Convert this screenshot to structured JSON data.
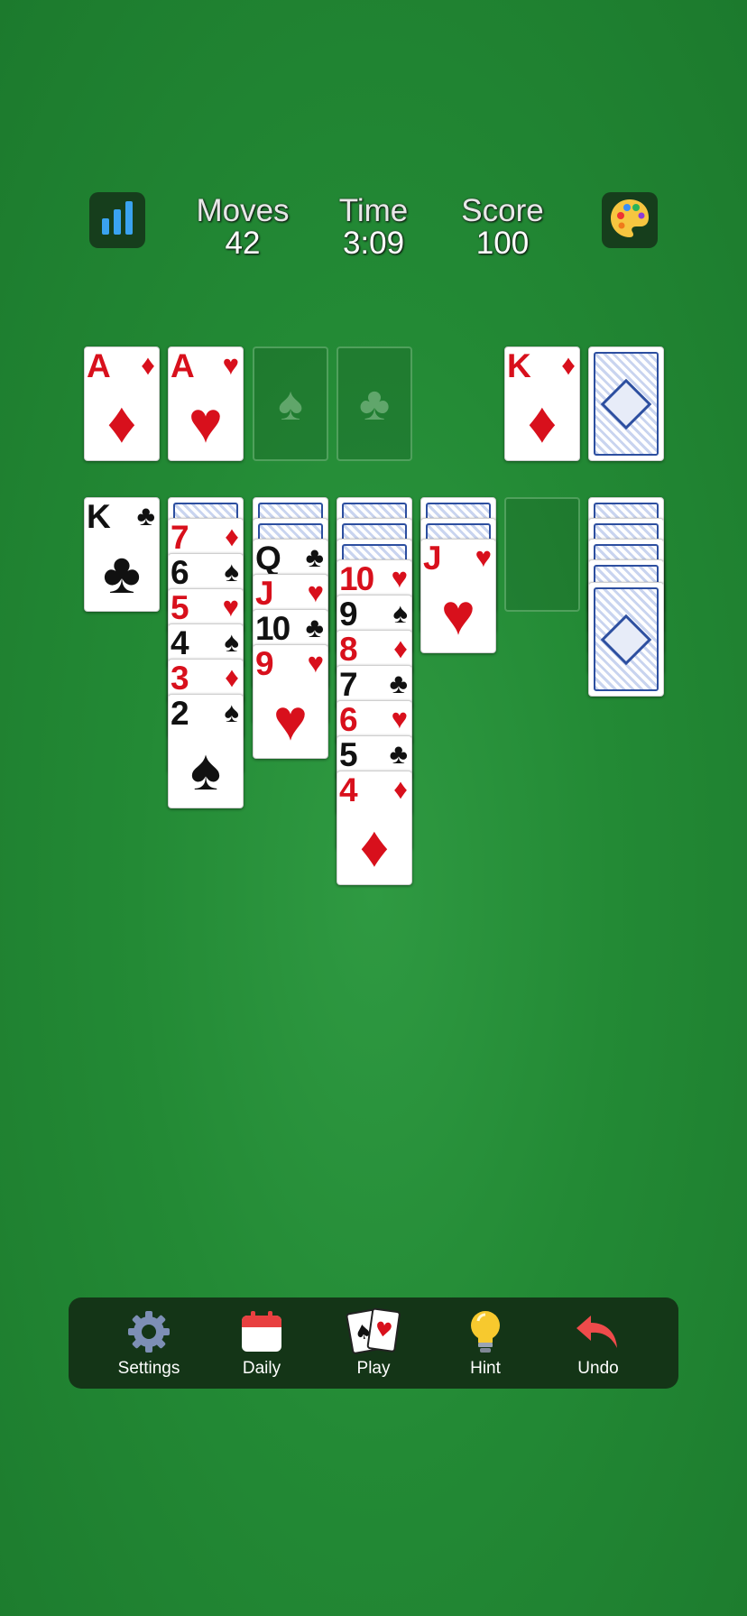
{
  "header": {
    "stats_icon": "bar-chart-icon",
    "theme_icon": "palette-icon",
    "moves_label": "Moves",
    "moves_value": "42",
    "time_label": "Time",
    "time_value": "3:09",
    "score_label": "Score",
    "score_value": "100"
  },
  "foundations": [
    {
      "rank": "A",
      "suit": "♦",
      "color": "red"
    },
    {
      "rank": "A",
      "suit": "♥",
      "color": "red"
    },
    {
      "empty_suit": "♠"
    },
    {
      "empty_suit": "♣"
    }
  ],
  "waste": {
    "rank": "K",
    "suit": "♦",
    "color": "red"
  },
  "stock": {
    "face_down": true
  },
  "tableau": [
    {
      "hidden": 0,
      "cards": [
        {
          "rank": "K",
          "suit": "♣",
          "color": "black"
        }
      ]
    },
    {
      "hidden": 1,
      "cards": [
        {
          "rank": "7",
          "suit": "♦",
          "color": "red"
        },
        {
          "rank": "6",
          "suit": "♠",
          "color": "black"
        },
        {
          "rank": "5",
          "suit": "♥",
          "color": "red"
        },
        {
          "rank": "4",
          "suit": "♠",
          "color": "black"
        },
        {
          "rank": "3",
          "suit": "♦",
          "color": "red"
        },
        {
          "rank": "2",
          "suit": "♠",
          "color": "black"
        }
      ]
    },
    {
      "hidden": 2,
      "cards": [
        {
          "rank": "Q",
          "suit": "♣",
          "color": "black"
        },
        {
          "rank": "J",
          "suit": "♥",
          "color": "red"
        },
        {
          "rank": "10",
          "suit": "♣",
          "color": "black"
        },
        {
          "rank": "9",
          "suit": "♥",
          "color": "red"
        }
      ]
    },
    {
      "hidden": 3,
      "cards": [
        {
          "rank": "10",
          "suit": "♥",
          "color": "red"
        },
        {
          "rank": "9",
          "suit": "♠",
          "color": "black"
        },
        {
          "rank": "8",
          "suit": "♦",
          "color": "red"
        },
        {
          "rank": "7",
          "suit": "♣",
          "color": "black"
        },
        {
          "rank": "6",
          "suit": "♥",
          "color": "red"
        },
        {
          "rank": "5",
          "suit": "♣",
          "color": "black"
        },
        {
          "rank": "4",
          "suit": "♦",
          "color": "red"
        }
      ]
    },
    {
      "hidden": 2,
      "cards": [
        {
          "rank": "J",
          "suit": "♥",
          "color": "red"
        }
      ]
    },
    {
      "hidden": 0,
      "cards": []
    },
    {
      "hidden": 5,
      "cards": []
    }
  ],
  "toolbar": {
    "settings_label": "Settings",
    "settings_icon": "gear-icon",
    "daily_label": "Daily",
    "daily_icon": "calendar-icon",
    "play_label": "Play",
    "play_icon": "cards-icon",
    "hint_label": "Hint",
    "hint_icon": "lightbulb-icon",
    "undo_label": "Undo",
    "undo_icon": "undo-arrow-icon"
  },
  "colors": {
    "felt": "#238a35",
    "red": "#d8101c",
    "card_back": "#2d4fa0"
  }
}
